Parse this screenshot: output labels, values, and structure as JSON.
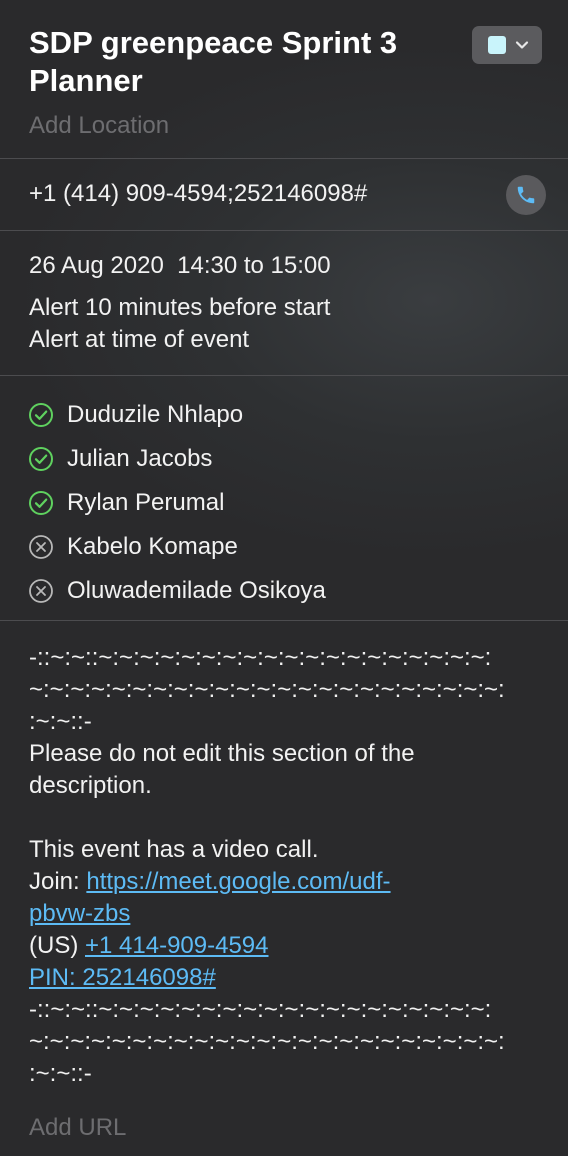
{
  "event": {
    "title_line1": "SDP greenpeace Sprint 3",
    "title_line2": "Planner",
    "location_placeholder": "Add Location",
    "calendar_color": "#c9f4fb"
  },
  "phone": {
    "number": "+1 (414) 909-4594;252146098#",
    "icon": "phone-icon"
  },
  "schedule": {
    "datetime": "26 Aug 2020  14:30 to 15:00",
    "alerts": [
      "Alert 10 minutes before start",
      "Alert at time of event"
    ]
  },
  "attendees": [
    {
      "name": "Duduzile Nhlapo",
      "status": "accepted",
      "icon": "check-circle-icon"
    },
    {
      "name": "Julian Jacobs",
      "status": "accepted",
      "icon": "check-circle-icon"
    },
    {
      "name": "Rylan Perumal",
      "status": "accepted",
      "icon": "check-circle-icon"
    },
    {
      "name": "Kabelo Komape",
      "status": "declined",
      "icon": "x-circle-icon"
    },
    {
      "name": "Oluwademilade Osikoya",
      "status": "declined",
      "icon": "x-circle-icon"
    }
  ],
  "notes": {
    "sep_line1": "-::~:~::~:~:~:~:~:~:~:~:~:~:~:~:~:~:~:~:~:~:~:",
    "sep_line2": "~:~:~:~:~:~:~:~:~:~:~:~:~:~:~:~:~:~:~:~:~:~:~:",
    "sep_line3": ":~:~::-",
    "warning_line1": "Please do not edit this section of the",
    "warning_line2": "description.",
    "video_call": "This event has a video call.",
    "join_label": "Join: ",
    "join_link_line1": "https://meet.google.com/udf-",
    "join_link_line2": "pbvw-zbs",
    "us_label": "(US) ",
    "us_phone": "+1 414-909-4594",
    "pin": "PIN: 252146098#",
    "sep_line4": "-::~:~::~:~:~:~:~:~:~:~:~:~:~:~:~:~:~:~:~:~:~:",
    "sep_line5": "~:~:~:~:~:~:~:~:~:~:~:~:~:~:~:~:~:~:~:~:~:~:~:",
    "sep_line6": ":~:~::-"
  },
  "url_placeholder": "Add URL",
  "colors": {
    "link": "#5dbbf5",
    "accepted": "#5fd15f",
    "declined": "#b8b8b8"
  }
}
